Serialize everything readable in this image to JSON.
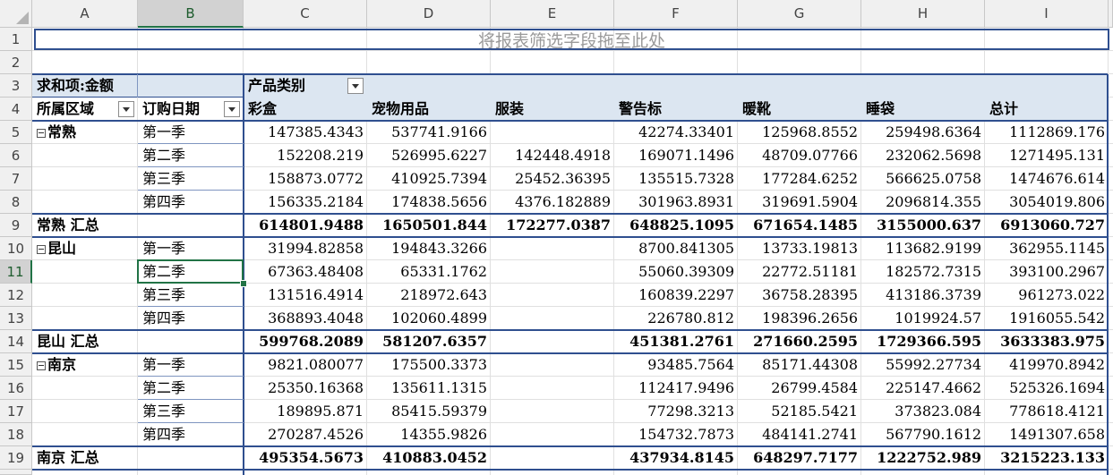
{
  "columns": [
    "A",
    "B",
    "C",
    "D",
    "E",
    "F",
    "G",
    "H",
    "I"
  ],
  "rows": [
    "1",
    "2",
    "3",
    "4",
    "5",
    "6",
    "7",
    "8",
    "9",
    "10",
    "11",
    "12",
    "13",
    "14",
    "15",
    "16",
    "17",
    "18",
    "19"
  ],
  "selected_cell": "B11",
  "drop_zone_text": "将报表筛选字段拖至此处",
  "pivot": {
    "values_label": "求和项:金额",
    "column_field": "产品类别",
    "row_field_1": "所属区域",
    "row_field_2": "订购日期",
    "categories": [
      "彩盒",
      "宠物用品",
      "服装",
      "警告标",
      "暖靴",
      "睡袋",
      "总计"
    ],
    "body": [
      {
        "region": "常熟",
        "quarter": "第一季",
        "values": [
          "147385.4343",
          "537741.9166",
          "",
          "42274.33401",
          "125968.8552",
          "259498.6364",
          "1112869.176"
        ],
        "collapse": true
      },
      {
        "region": "",
        "quarter": "第二季",
        "values": [
          "152208.219",
          "526995.6227",
          "142448.4918",
          "169071.1496",
          "48709.07766",
          "232062.5698",
          "1271495.131"
        ]
      },
      {
        "region": "",
        "quarter": "第三季",
        "values": [
          "158873.0772",
          "410925.7394",
          "25452.36395",
          "135515.7328",
          "177284.6252",
          "566625.0758",
          "1474676.614"
        ]
      },
      {
        "region": "",
        "quarter": "第四季",
        "values": [
          "156335.2184",
          "174838.5656",
          "4376.182889",
          "301963.8931",
          "319691.5904",
          "2096814.355",
          "3054019.806"
        ]
      },
      {
        "subtotal": "常熟 汇总",
        "values": [
          "614801.9488",
          "1650501.844",
          "172277.0387",
          "648825.1095",
          "671654.1485",
          "3155000.637",
          "6913060.727"
        ]
      },
      {
        "region": "昆山",
        "quarter": "第一季",
        "values": [
          "31994.82858",
          "194843.3266",
          "",
          "8700.841305",
          "13733.19813",
          "113682.9199",
          "362955.1145"
        ],
        "collapse": true
      },
      {
        "region": "",
        "quarter": "第二季",
        "values": [
          "67363.48408",
          "65331.1762",
          "",
          "55060.39309",
          "22772.51181",
          "182572.7315",
          "393100.2967"
        ]
      },
      {
        "region": "",
        "quarter": "第三季",
        "values": [
          "131516.4914",
          "218972.643",
          "",
          "160839.2297",
          "36758.28395",
          "413186.3739",
          "961273.022"
        ]
      },
      {
        "region": "",
        "quarter": "第四季",
        "values": [
          "368893.4048",
          "102060.4899",
          "",
          "226780.812",
          "198396.2656",
          "1019924.57",
          "1916055.542"
        ]
      },
      {
        "subtotal": "昆山 汇总",
        "values": [
          "599768.2089",
          "581207.6357",
          "",
          "451381.2761",
          "271660.2595",
          "1729366.595",
          "3633383.975"
        ]
      },
      {
        "region": "南京",
        "quarter": "第一季",
        "values": [
          "9821.080077",
          "175500.3373",
          "",
          "93485.7564",
          "85171.44308",
          "55992.27734",
          "419970.8942"
        ],
        "collapse": true
      },
      {
        "region": "",
        "quarter": "第二季",
        "values": [
          "25350.16368",
          "135611.1315",
          "",
          "112417.9496",
          "26799.4584",
          "225147.4662",
          "525326.1694"
        ]
      },
      {
        "region": "",
        "quarter": "第三季",
        "values": [
          "189895.871",
          "85415.59379",
          "",
          "77298.3213",
          "52185.5421",
          "373823.084",
          "778618.4121"
        ]
      },
      {
        "region": "",
        "quarter": "第四季",
        "values": [
          "270287.4526",
          "14355.9826",
          "",
          "154732.7873",
          "484141.2741",
          "567790.1612",
          "1491307.658"
        ]
      },
      {
        "subtotal": "南京 汇总",
        "values": [
          "495354.5673",
          "410883.0452",
          "",
          "437934.8145",
          "648297.7177",
          "1222752.989",
          "3215223.133"
        ]
      }
    ]
  }
}
